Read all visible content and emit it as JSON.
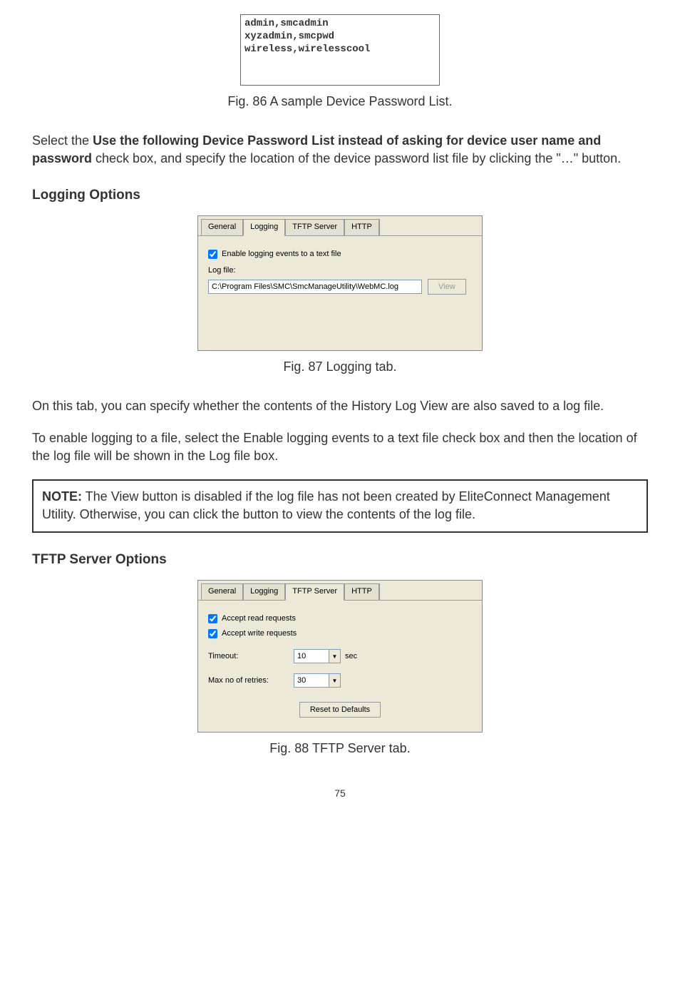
{
  "device_password_list": "admin,smcadmin\nxyzadmin,smcpwd\nwireless,wirelesscool",
  "fig86_caption": "Fig. 86 A sample Device Password List.",
  "para1_prefix": "Select the ",
  "para1_bold": "Use the following Device Password List instead of asking for device user name and password",
  "para1_suffix": " check box, and specify the location of the device password list file by clicking the \"…\" button.",
  "heading_logging": "Logging Options",
  "tabs": {
    "general": "General",
    "logging": "Logging",
    "tftp": "TFTP Server",
    "http": "HTTP"
  },
  "logging_panel": {
    "enable_label": "Enable logging events to a text file",
    "logfile_label": "Log file:",
    "logfile_value": "C:\\Program Files\\SMC\\SmcManageUtility\\WebMC.log",
    "view_btn": "View"
  },
  "fig87_caption": "Fig. 87 Logging tab.",
  "para2": "On this tab, you can specify whether the contents of the History Log View are also saved to a log file.",
  "para3": "To enable logging to a file, select the Enable logging events to a text file check box and then the location of the log file will be shown in the Log file box.",
  "note_label": "NOTE:",
  "note_text": " The View button is disabled if the log file has not been created by EliteConnect Management Utility. Otherwise, you can click the button to view the contents of the log file.",
  "heading_tftp": "TFTP Server Options",
  "tftp_panel": {
    "accept_read": "Accept read requests",
    "accept_write": "Accept write requests",
    "timeout_label": "Timeout:",
    "timeout_value": "10",
    "timeout_unit": "sec",
    "retries_label": "Max no of retries:",
    "retries_value": "30",
    "reset_btn": "Reset to Defaults"
  },
  "fig88_caption": "Fig. 88 TFTP Server tab.",
  "page_number": "75"
}
